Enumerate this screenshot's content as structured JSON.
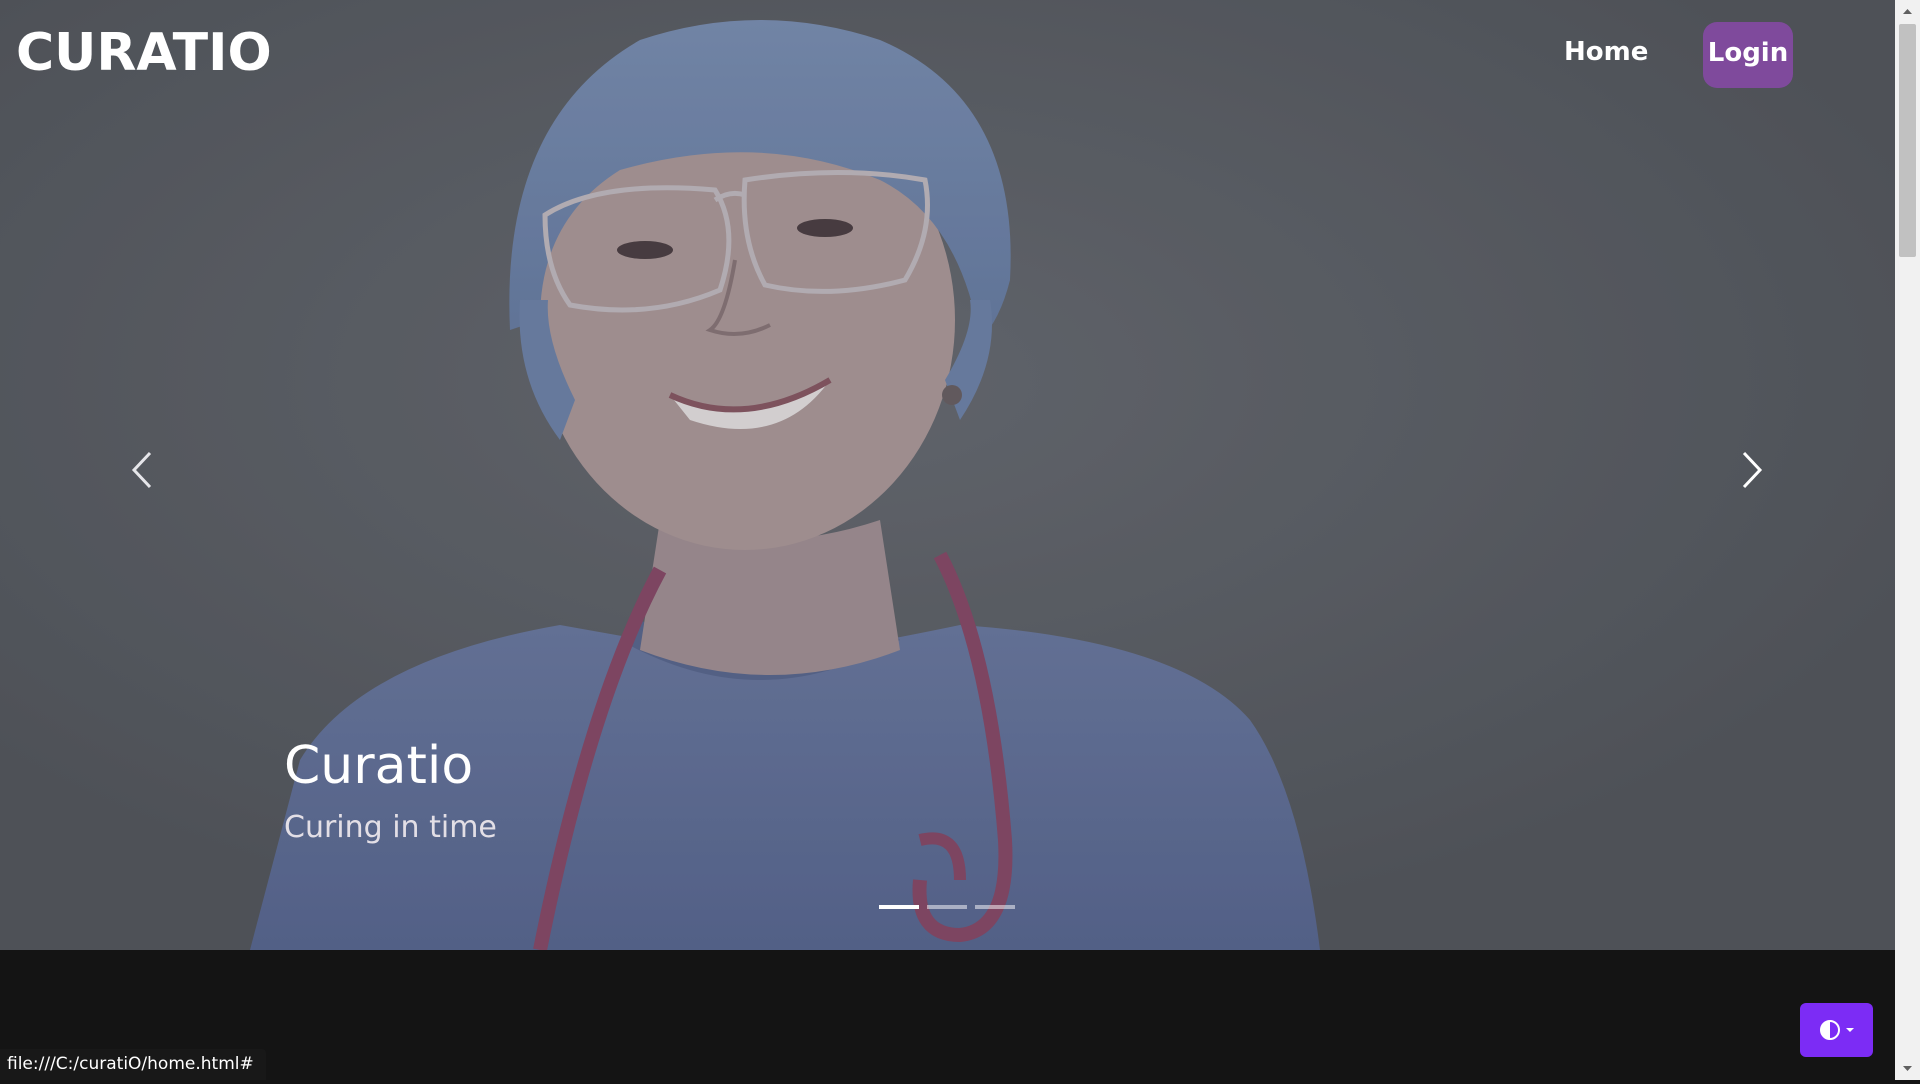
{
  "brand": "CURATIO",
  "nav": {
    "home_label": "Home",
    "login_label": "Login"
  },
  "carousel": {
    "caption_title": "Curatio",
    "caption_subtitle": "Curing in time",
    "slide_count": 3,
    "active_slide": 1,
    "prev_icon": "chevron-left-icon",
    "next_icon": "chevron-right-icon"
  },
  "theme_toggle": {
    "icon": "contrast-icon",
    "caret_icon": "caret-down-icon"
  },
  "status_bar": {
    "url": "file:///C:/curatiO/home.html#"
  },
  "colors": {
    "login_bg": "#7f4a9c",
    "theme_btn_bg": "#7c2cf5",
    "footer_bg": "#141414"
  }
}
